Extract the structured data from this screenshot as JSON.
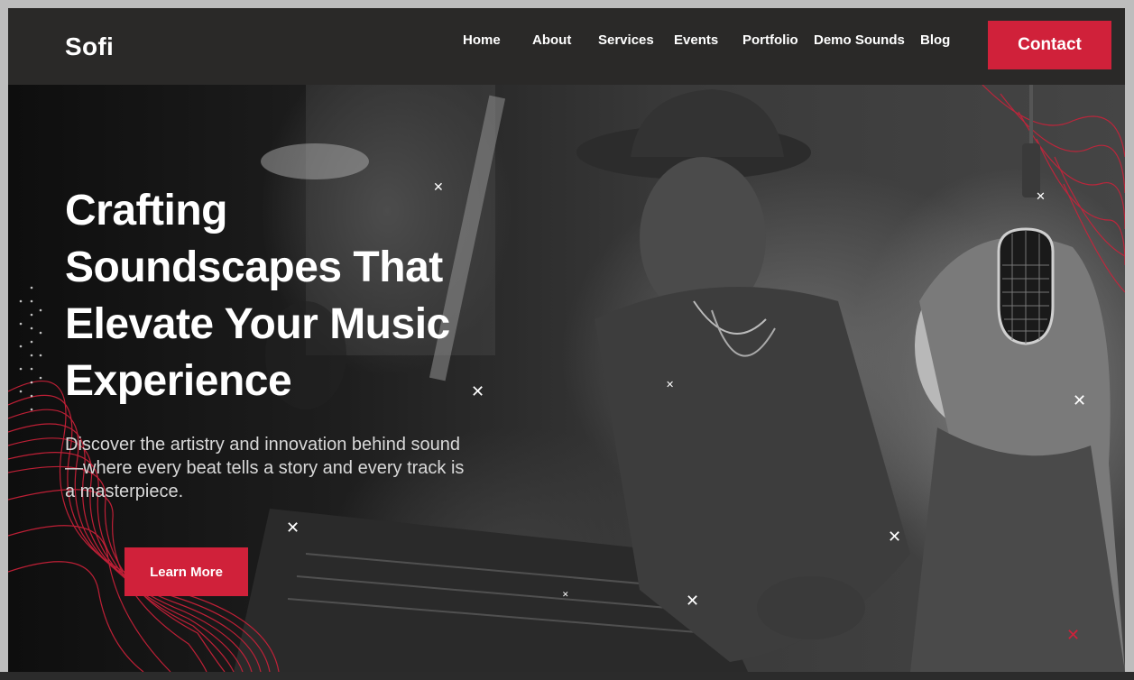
{
  "nav": {
    "logo": "Sofi",
    "links": [
      "Home",
      "About",
      "Services",
      "Events",
      "Portfolio",
      "Demo Sounds",
      "Blog"
    ],
    "contact_label": "Contact"
  },
  "hero": {
    "headline_lines": [
      "Crafting",
      "Soundscapes That",
      "Elevate Your Music",
      "Experience"
    ],
    "subtext": "Discover the artistry and innovation behind sound—where every beat tells a story and every track is a masterpiece.",
    "cta_label": "Learn More"
  },
  "colors": {
    "accent": "#d0213a",
    "nav_bg": "#2a2928"
  },
  "icons": [
    "x-sparkle-icon",
    "microphone-icon"
  ]
}
